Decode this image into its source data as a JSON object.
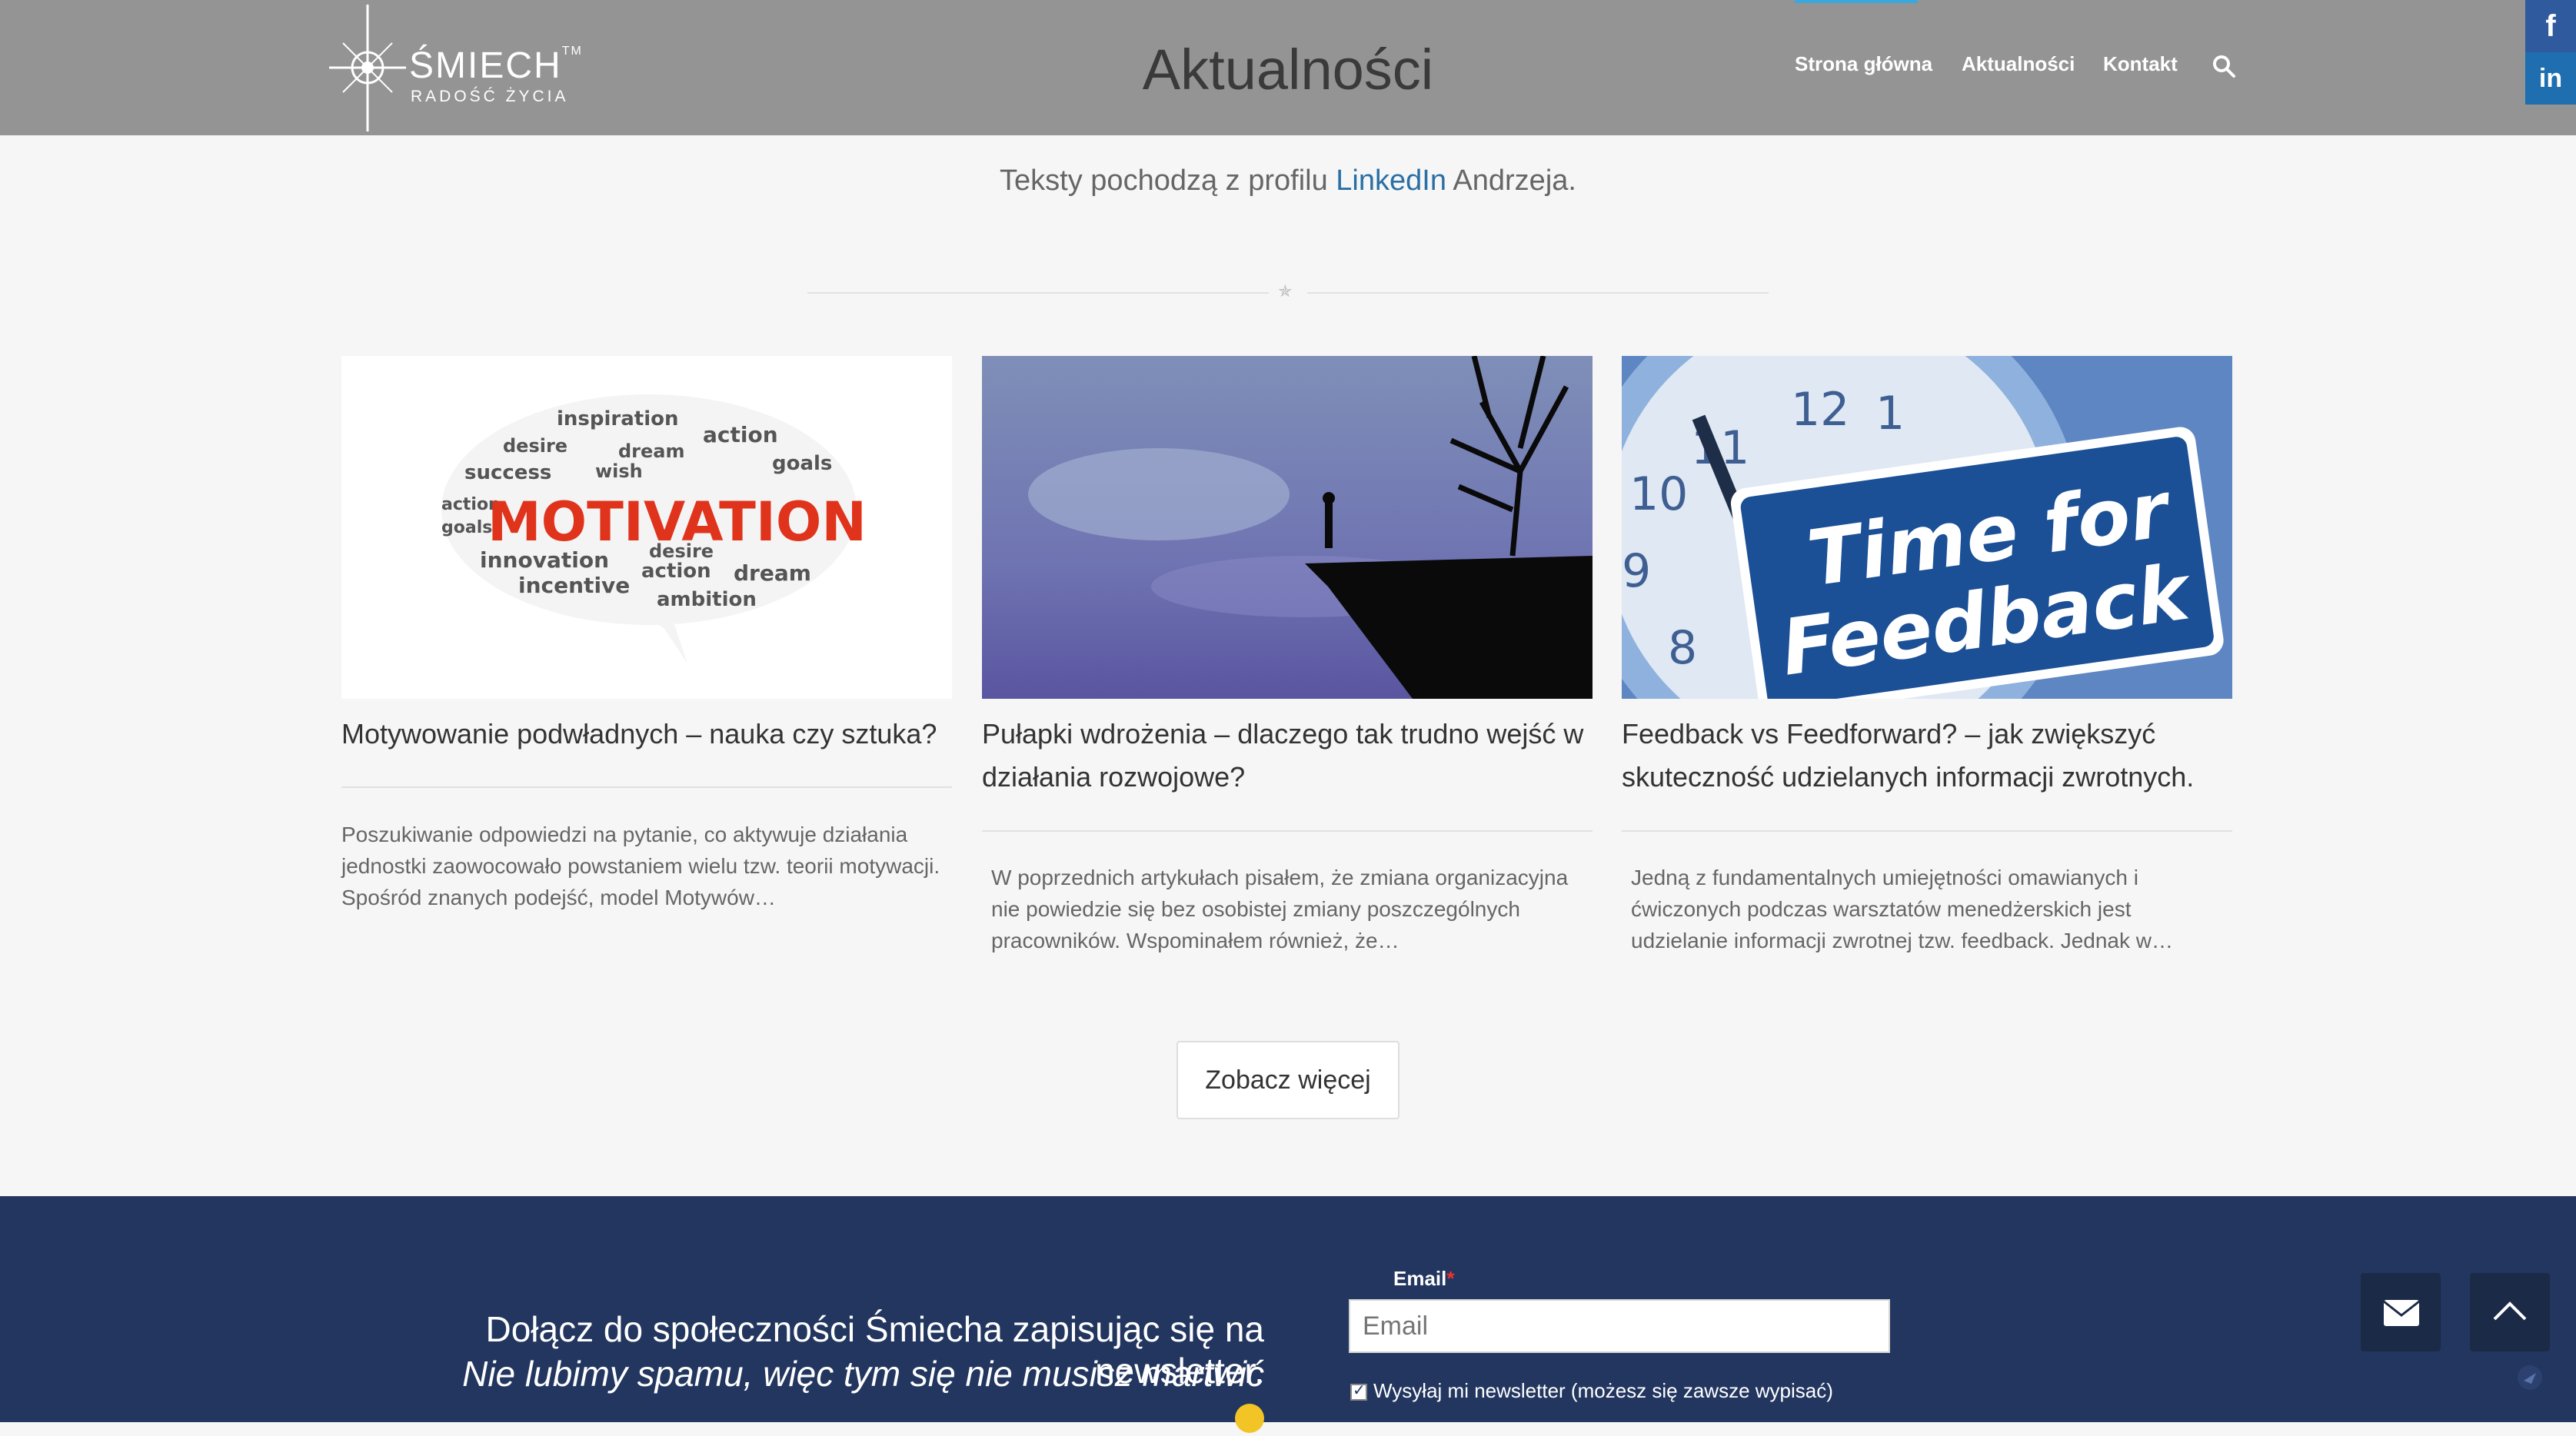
{
  "header": {
    "logo_name": "ŚMIECH",
    "logo_tm": "TM",
    "logo_tagline": "RADOŚĆ ŻYCIA",
    "page_title": "Aktualności",
    "nav": [
      "Strona główna",
      "Aktualności",
      "Kontakt"
    ],
    "nav_search_icon": "search-icon"
  },
  "social": {
    "facebook": "f",
    "linkedin": "in"
  },
  "intro": {
    "before": "Teksty pochodzą z profilu ",
    "link": "LinkedIn",
    "after": " Andrzeja."
  },
  "posts": [
    {
      "image_word": "MOTIVATION",
      "title": "Motywowanie podwładnych – nauka czy sztuka?",
      "excerpt": "Poszukiwanie odpowiedzi na pytanie, co aktywuje działania jednostki zaowocowało powstaniem wielu tzw. teorii motywacji. Spośród znanych podejść, model Motywów…"
    },
    {
      "title": "Pułapki wdrożenia – dlaczego tak trudno wejść w działania rozwojowe?",
      "excerpt": "W poprzednich artykułach pisałem, że zmiana organizacyjna nie powiedzie się bez osobistej zmiany poszczególnych pracowników. Wspominałem również, że…"
    },
    {
      "image_sign_line1": "Time for",
      "image_sign_line2": "Feedback",
      "title": "Feedback vs Feedforward? – jak zwiększyć skuteczność udzielanych informacji zwrotnych.",
      "excerpt": "Jedną z fundamentalnych umiejętności omawianych i ćwiczonych podczas warsztatów menedżerskich jest udzielanie informacji zwrotnej tzw. feedback. Jednak w…"
    }
  ],
  "more_button": "Zobacz więcej",
  "newsletter": {
    "line1": "Dołącz do społeczności Śmiecha zapisując się na newsletter.",
    "line2": "Nie lubimy spamu, więc tym się nie musisz martwić",
    "email_label": "Email",
    "required_mark": "*",
    "email_placeholder": "Email",
    "checkbox_label": "Wysyłaj mi newsletter (możesz się zawsze wypisać)"
  },
  "colors": {
    "header_bg": "#949494",
    "footer_bg": "#22365f",
    "link": "#2a6fa5",
    "accent": "#3aa8dd"
  }
}
